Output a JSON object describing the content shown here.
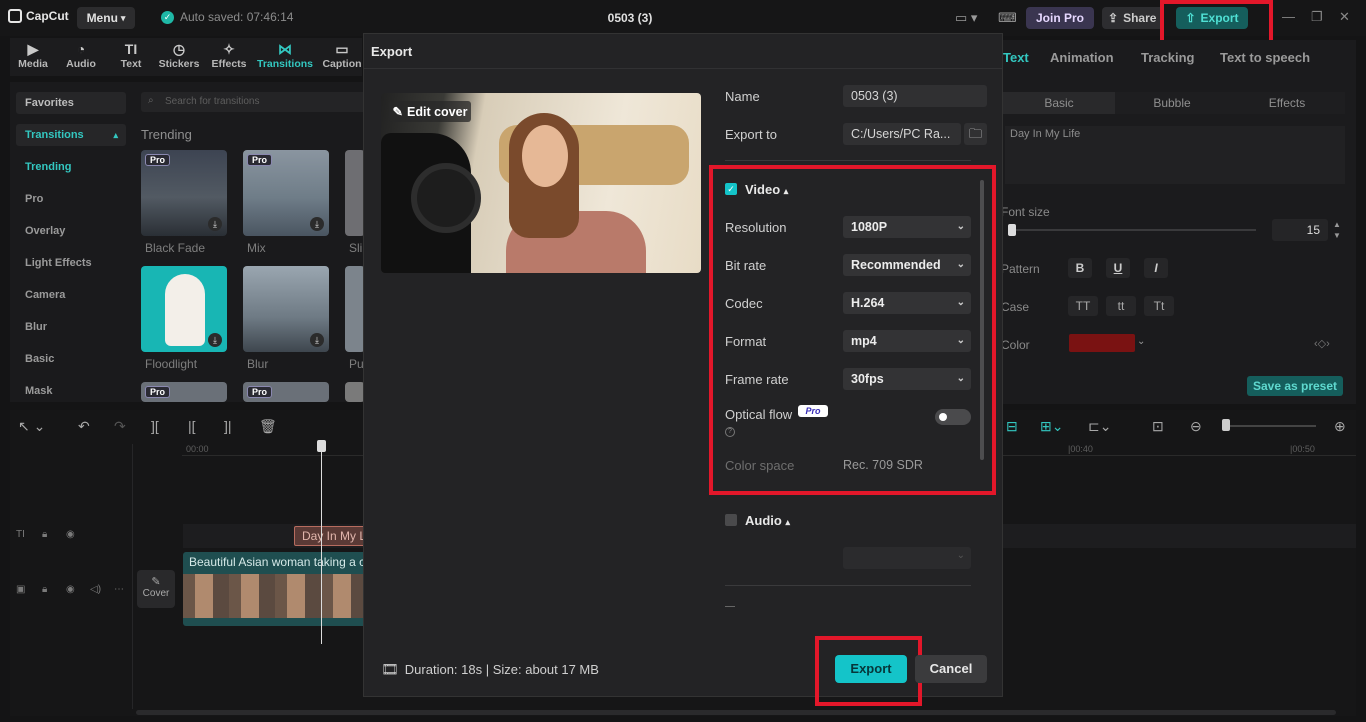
{
  "app": {
    "logo_text": "CapCut",
    "menu_label": "Menu",
    "autosave": "Auto saved: 07:46:14",
    "project_title": "0503 (3)"
  },
  "topbar": {
    "join_pro": "Join Pro",
    "share": "Share",
    "export": "Export"
  },
  "toolbar": {
    "items": [
      "Media",
      "Audio",
      "Text",
      "Stickers",
      "Effects",
      "Transitions",
      "Caption"
    ]
  },
  "left_nav": {
    "items": [
      "Favorites",
      "Transitions",
      "Trending",
      "Pro",
      "Overlay",
      "Light Effects",
      "Camera",
      "Blur",
      "Basic",
      "Mask"
    ]
  },
  "panel": {
    "search_placeholder": "Search for transitions",
    "section": "Trending",
    "thumbs": [
      {
        "label": "Black Fade",
        "pro": "Pro"
      },
      {
        "label": "Mix",
        "pro": "Pro"
      },
      {
        "label": "Sli"
      },
      {
        "label": "Floodlight"
      },
      {
        "label": "Blur"
      },
      {
        "label": "Pu"
      }
    ],
    "pro_badge": "Pro"
  },
  "right_panel": {
    "tabs": [
      "Text",
      "Animation",
      "Tracking",
      "Text to speech"
    ],
    "subtabs": [
      "Basic",
      "Bubble",
      "Effects"
    ],
    "text_value": "Day In My Life",
    "font_size_label": "Font size",
    "font_size_value": "15",
    "pattern_label": "Pattern",
    "pattern_buttons": [
      "B",
      "U",
      "I"
    ],
    "case_label": "Case",
    "case_buttons": [
      "TT",
      "tt",
      "Tt"
    ],
    "color_label": "Color",
    "color_value": "#7a1212",
    "save_preset": "Save as preset"
  },
  "timeline": {
    "ticks": [
      "00:00",
      "|00:40",
      "|00:50"
    ],
    "text_clip": "Day In My Life",
    "video_clip": "Beautiful Asian woman taking a c",
    "cover_label": "Cover"
  },
  "dialog": {
    "title": "Export",
    "edit_cover": "Edit cover",
    "name_label": "Name",
    "name_value": "0503 (3)",
    "export_to_label": "Export to",
    "export_to_value": "C:/Users/PC Ra...",
    "video_section": "Video",
    "resolution_label": "Resolution",
    "resolution_value": "1080P",
    "bitrate_label": "Bit rate",
    "bitrate_value": "Recommended",
    "codec_label": "Codec",
    "codec_value": "H.264",
    "format_label": "Format",
    "format_value": "mp4",
    "framerate_label": "Frame rate",
    "framerate_value": "30fps",
    "optical_flow_label": "Optical flow",
    "optical_flow_badge": "Pro",
    "optical_flow_on": false,
    "colorspace_label": "Color space",
    "colorspace_value": "Rec. 709 SDR",
    "audio_section": "Audio",
    "duration_text": "Duration: 18s | Size: about 17 MB",
    "export_button": "Export",
    "cancel_button": "Cancel"
  },
  "colors": {
    "accent": "#14c4c9",
    "highlight": "#e3172a"
  }
}
